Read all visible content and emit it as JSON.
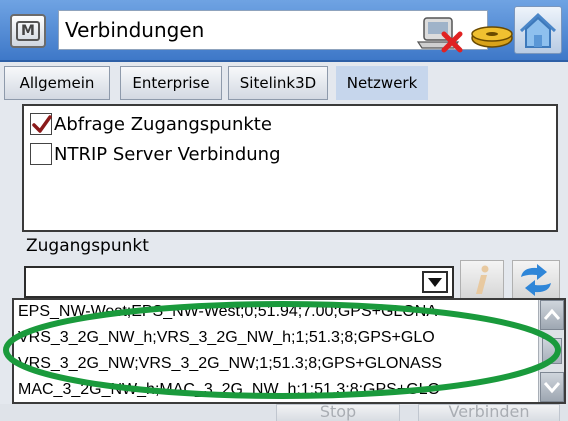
{
  "window": {
    "title": "Verbindungen",
    "menu_label": "M",
    "icons": [
      "device-disconnected-icon",
      "receiver-icon",
      "home-icon"
    ]
  },
  "tabs": [
    {
      "label": "Allgemein",
      "active": false
    },
    {
      "label": "Enterprise",
      "active": false
    },
    {
      "label": "Sitelink3D",
      "active": false
    },
    {
      "label": "Netzwerk",
      "active": true
    }
  ],
  "options": [
    {
      "label": "Abfrage Zugangspunkte",
      "checked": true
    },
    {
      "label": "NTRIP Server Verbindung",
      "checked": false
    }
  ],
  "access_point": {
    "label": "Zugangspunkt",
    "value": "",
    "list": [
      "EPS_NW-West;EPS_NW-West;0;51.94;7.00;GPS+GLONA",
      "VRS_3_2G_NW_h;VRS_3_2G_NW_h;1;51.3;8;GPS+GLO",
      "VRS_3_2G_NW;VRS_3_2G_NW;1;51.3;8;GPS+GLONASS",
      "MAC_3_2G_NW_h;MAC_3_2G_NW_h;1;51.3;8;GPS+GLO"
    ]
  },
  "footer": {
    "stop_label": "Stop",
    "connect_label": "Verbinden"
  },
  "colors": {
    "titlebar": "#3e78c8",
    "highlight_ellipse": "#1a9a3c",
    "checkmark": "#8b1a1a",
    "active_tab": "#c6d6ec"
  }
}
